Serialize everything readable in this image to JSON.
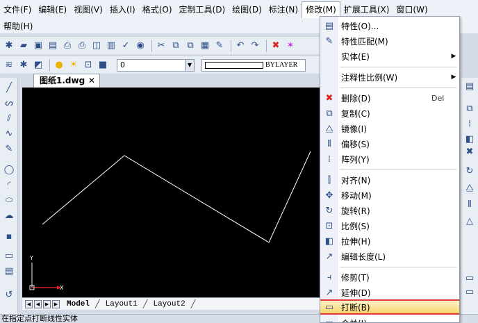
{
  "menubar": {
    "row1": [
      "文件(F)",
      "编辑(E)",
      "视图(V)",
      "插入(I)",
      "格式(O)",
      "定制工具(D)",
      "绘图(D)",
      "标注(N)",
      "修改(M)",
      "扩展工具(X)",
      "窗口(W)"
    ],
    "row2": [
      "帮助(H)"
    ],
    "active": "修改(M)"
  },
  "layer_toolbar": {
    "layer_value": "0",
    "color_value": "BYLAYER"
  },
  "document": {
    "tab_title": "图纸1.dwg",
    "close_glyph": "✕"
  },
  "layout_tabs": [
    "Model",
    "Layout1",
    "Layout2"
  ],
  "ucs": {
    "y": "Y",
    "x": "X"
  },
  "status": {
    "text": "在指定点打断线性实体"
  },
  "modify_menu": {
    "items": [
      {
        "label": "特性(O)...",
        "icon": "properties-icon"
      },
      {
        "label": "特性匹配(M)",
        "icon": "match-properties-icon"
      },
      {
        "label": "实体(E)",
        "icon": "none",
        "submenu": true
      },
      {
        "label": "注释性比例(W)",
        "icon": "none",
        "submenu": true
      },
      {
        "label": "删除(D)",
        "icon": "delete-icon",
        "shortcut": "Del"
      },
      {
        "label": "复制(C)",
        "icon": "copy-icon"
      },
      {
        "label": "镜像(I)",
        "icon": "mirror-icon"
      },
      {
        "label": "偏移(S)",
        "icon": "offset-icon"
      },
      {
        "label": "阵列(Y)",
        "icon": "array-icon"
      },
      {
        "label": "对齐(N)",
        "icon": "align-icon"
      },
      {
        "label": "移动(M)",
        "icon": "move-icon"
      },
      {
        "label": "旋转(R)",
        "icon": "rotate-icon"
      },
      {
        "label": "比例(S)",
        "icon": "scale-icon"
      },
      {
        "label": "拉伸(H)",
        "icon": "stretch-icon"
      },
      {
        "label": "编辑长度(L)",
        "icon": "lengthen-icon"
      },
      {
        "label": "修剪(T)",
        "icon": "trim-icon"
      },
      {
        "label": "延伸(D)",
        "icon": "extend-icon"
      },
      {
        "label": "打断(B)",
        "icon": "break-icon",
        "highlighted": true
      },
      {
        "label": "合并(J)",
        "icon": "join-icon"
      }
    ]
  },
  "colors": {
    "canvas": "#000000",
    "polyline": "#ffffff",
    "highlight_border": "#e03a3a",
    "highlight_fill": "#f7d46d"
  }
}
